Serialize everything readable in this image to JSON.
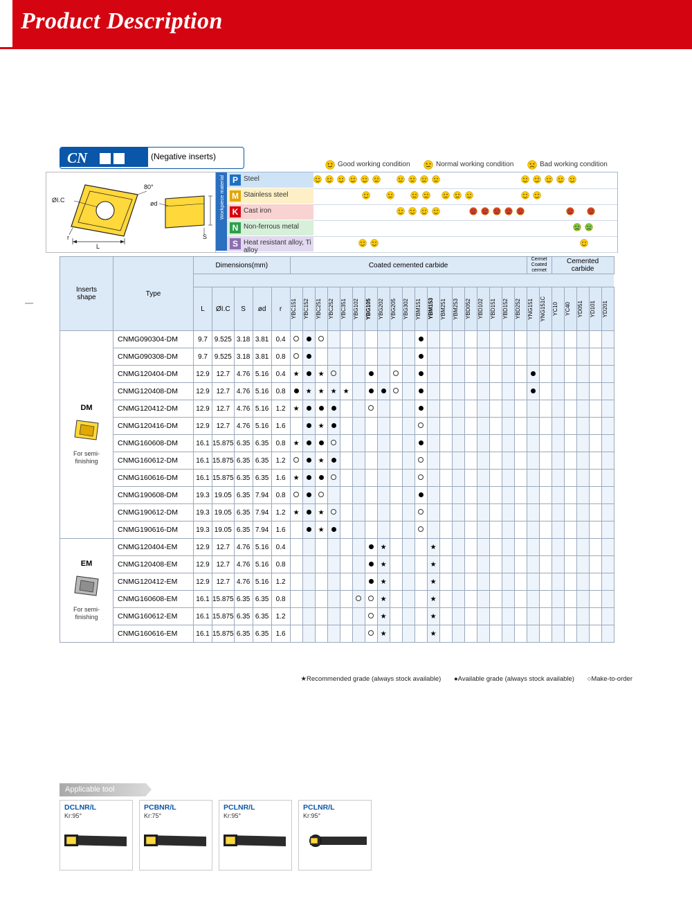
{
  "header": {
    "title": "Product Description"
  },
  "cn": {
    "code": "CN",
    "note": "(Negative inserts)"
  },
  "legend": {
    "good": "Good working condition",
    "normal": "Normal working condition",
    "bad": "Bad working condition"
  },
  "workpiece": {
    "axis_label": "Workpiece material",
    "rows": [
      {
        "key": "P",
        "label": "Steel",
        "color": "#1f6fc4"
      },
      {
        "key": "M",
        "label": "Stainless steel",
        "color": "#e2a400"
      },
      {
        "key": "K",
        "label": "Cast iron",
        "color": "#d40511"
      },
      {
        "key": "N",
        "label": "Non-ferrous metal",
        "color": "#2e9e4e"
      },
      {
        "key": "S",
        "label": "Heat resistant alloy, Ti alloy",
        "color": "#8c6fb0"
      }
    ]
  },
  "table": {
    "headers": {
      "inserts_shape": "Inserts shape",
      "type": "Type",
      "dimensions": "Dimensions(mm)",
      "coated": "Coated cemented carbide",
      "cermet": "Cermet Coated cermet",
      "cemented": "Cemented carbide",
      "dims": [
        "L",
        "ØI.C",
        "S",
        "ød",
        "r"
      ]
    },
    "grades": [
      "YBC151",
      "YBC152",
      "YBC251",
      "YBC252",
      "YBC351",
      "YBG102",
      "YBG105",
      "YBG202",
      "YBG205",
      "YBG302",
      "YBM151",
      "YBM153",
      "YBM251",
      "YBM253",
      "YBD052",
      "YBD102",
      "YBD151",
      "YBD152",
      "YBD252",
      "YNG151",
      "YNG151C",
      "YC10",
      "YC40",
      "YD051",
      "YD101",
      "YD201"
    ],
    "bold_grades": [
      "YBG105",
      "YBM153"
    ],
    "groups": [
      {
        "name": "DM",
        "sub": "For semi-finishing",
        "rows": [
          {
            "type": "CNMG090304-DM",
            "L": "9.7",
            "ic": "9.525",
            "s": "3.18",
            "d": "3.81",
            "r": "0.4",
            "marks": {
              "YBC151": "o",
              "YBC152": "f",
              "YBC251": "o",
              "YBM151": "f"
            }
          },
          {
            "type": "CNMG090308-DM",
            "L": "9.7",
            "ic": "9.525",
            "s": "3.18",
            "d": "3.81",
            "r": "0.8",
            "marks": {
              "YBC151": "o",
              "YBC152": "f",
              "YBM151": "f"
            }
          },
          {
            "type": "CNMG120404-DM",
            "L": "12.9",
            "ic": "12.7",
            "s": "4.76",
            "d": "5.16",
            "r": "0.4",
            "marks": {
              "YBC151": "s",
              "YBC152": "f",
              "YBC251": "s",
              "YBC252": "o",
              "YBG105": "f",
              "YBG205": "o",
              "YBM151": "f",
              "YNG151": "f"
            }
          },
          {
            "type": "CNMG120408-DM",
            "L": "12.9",
            "ic": "12.7",
            "s": "4.76",
            "d": "5.16",
            "r": "0.8",
            "marks": {
              "YBC151": "f",
              "YBC152": "s",
              "YBC251": "s",
              "YBC252": "s",
              "YBC351": "s",
              "YBG105": "f",
              "YBG202": "f",
              "YBG205": "o",
              "YBM151": "f",
              "YNG151": "f"
            }
          },
          {
            "type": "CNMG120412-DM",
            "L": "12.9",
            "ic": "12.7",
            "s": "4.76",
            "d": "5.16",
            "r": "1.2",
            "marks": {
              "YBC151": "s",
              "YBC152": "f",
              "YBC251": "f",
              "YBC252": "f",
              "YBG105": "o",
              "YBM151": "f"
            }
          },
          {
            "type": "CNMG120416-DM",
            "L": "12.9",
            "ic": "12.7",
            "s": "4.76",
            "d": "5.16",
            "r": "1.6",
            "marks": {
              "YBC152": "f",
              "YBC251": "s",
              "YBC252": "f",
              "YBM151": "o"
            }
          },
          {
            "type": "CNMG160608-DM",
            "L": "16.1",
            "ic": "15.875",
            "s": "6.35",
            "d": "6.35",
            "r": "0.8",
            "marks": {
              "YBC151": "s",
              "YBC152": "f",
              "YBC251": "f",
              "YBC252": "o",
              "YBM151": "f"
            }
          },
          {
            "type": "CNMG160612-DM",
            "L": "16.1",
            "ic": "15.875",
            "s": "6.35",
            "d": "6.35",
            "r": "1.2",
            "marks": {
              "YBC151": "o",
              "YBC152": "f",
              "YBC251": "s",
              "YBC252": "f",
              "YBM151": "o"
            }
          },
          {
            "type": "CNMG160616-DM",
            "L": "16.1",
            "ic": "15.875",
            "s": "6.35",
            "d": "6.35",
            "r": "1.6",
            "marks": {
              "YBC151": "s",
              "YBC152": "f",
              "YBC251": "f",
              "YBC252": "o",
              "YBM151": "o"
            }
          },
          {
            "type": "CNMG190608-DM",
            "L": "19.3",
            "ic": "19.05",
            "s": "6.35",
            "d": "7.94",
            "r": "0.8",
            "marks": {
              "YBC151": "o",
              "YBC152": "f",
              "YBC251": "o",
              "YBM151": "f"
            }
          },
          {
            "type": "CNMG190612-DM",
            "L": "19.3",
            "ic": "19.05",
            "s": "6.35",
            "d": "7.94",
            "r": "1.2",
            "marks": {
              "YBC151": "s",
              "YBC152": "f",
              "YBC251": "s",
              "YBC252": "o",
              "YBM151": "o"
            }
          },
          {
            "type": "CNMG190616-DM",
            "L": "19.3",
            "ic": "19.05",
            "s": "6.35",
            "d": "7.94",
            "r": "1.6",
            "marks": {
              "YBC152": "f",
              "YBC251": "s",
              "YBC252": "f",
              "YBM151": "o"
            }
          }
        ]
      },
      {
        "name": "EM",
        "sub": "For semi-finishing",
        "rows": [
          {
            "type": "CNMG120404-EM",
            "L": "12.9",
            "ic": "12.7",
            "s": "4.76",
            "d": "5.16",
            "r": "0.4",
            "marks": {
              "YBG105": "f",
              "YBG202": "s",
              "YBM153": "s"
            }
          },
          {
            "type": "CNMG120408-EM",
            "L": "12.9",
            "ic": "12.7",
            "s": "4.76",
            "d": "5.16",
            "r": "0.8",
            "marks": {
              "YBG105": "f",
              "YBG202": "s",
              "YBM153": "s"
            }
          },
          {
            "type": "CNMG120412-EM",
            "L": "12.9",
            "ic": "12.7",
            "s": "4.76",
            "d": "5.16",
            "r": "1.2",
            "marks": {
              "YBG105": "f",
              "YBG202": "s",
              "YBM153": "s"
            }
          },
          {
            "type": "CNMG160608-EM",
            "L": "16.1",
            "ic": "15.875",
            "s": "6.35",
            "d": "6.35",
            "r": "0.8",
            "marks": {
              "YBG102": "o",
              "YBG105": "o",
              "YBG202": "s",
              "YBM153": "s"
            }
          },
          {
            "type": "CNMG160612-EM",
            "L": "16.1",
            "ic": "15.875",
            "s": "6.35",
            "d": "6.35",
            "r": "1.2",
            "marks": {
              "YBG105": "o",
              "YBG202": "s",
              "YBM153": "s"
            }
          },
          {
            "type": "CNMG160616-EM",
            "L": "16.1",
            "ic": "15.875",
            "s": "6.35",
            "d": "6.35",
            "r": "1.6",
            "marks": {
              "YBG105": "o",
              "YBG202": "s",
              "YBM153": "s"
            }
          }
        ]
      }
    ]
  },
  "footnote": {
    "recommended": "★Recommended grade (always stock available)",
    "available": "●Available grade (always stock available)",
    "make_to_order": "○Make-to-order"
  },
  "applicable_tool": {
    "title": "Applicable tool",
    "items": [
      {
        "name": "DCLNR/L",
        "angle": "Kr:95°"
      },
      {
        "name": "PCBNR/L",
        "angle": "Kr:75°"
      },
      {
        "name": "PCLNR/L",
        "angle": "Kr:95°"
      },
      {
        "name": "PCLNR/L",
        "angle": "Kr:95°"
      }
    ]
  },
  "geometry": {
    "angle": "80°",
    "ic": "ØI.C",
    "d": "ød",
    "r": "r",
    "l": "L",
    "s": "S"
  }
}
